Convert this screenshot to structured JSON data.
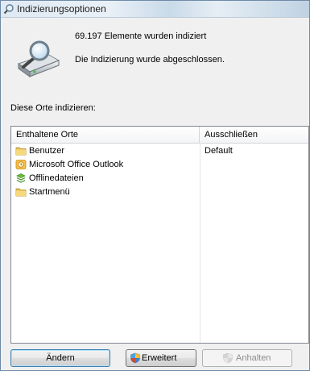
{
  "window": {
    "title": "Indizierungsoptionen"
  },
  "status": {
    "indexed_count": "69.197 Elemente wurden indiziert",
    "completion": "Die Indizierung wurde abgeschlossen."
  },
  "locations": {
    "section_label": "Diese Orte indizieren:",
    "col_included": "Enthaltene Orte",
    "col_excluded": "Ausschließen",
    "items": [
      {
        "name": "Benutzer",
        "exclude": "Default",
        "icon": "folder-icon"
      },
      {
        "name": "Microsoft Office Outlook",
        "exclude": "",
        "icon": "outlook-icon"
      },
      {
        "name": "Offlinedateien",
        "exclude": "",
        "icon": "offline-files-icon"
      },
      {
        "name": "Startmenü",
        "exclude": "",
        "icon": "folder-icon"
      }
    ]
  },
  "buttons": {
    "modify": "Ändern",
    "advanced": "Erweitert",
    "pause": "Anhalten"
  }
}
